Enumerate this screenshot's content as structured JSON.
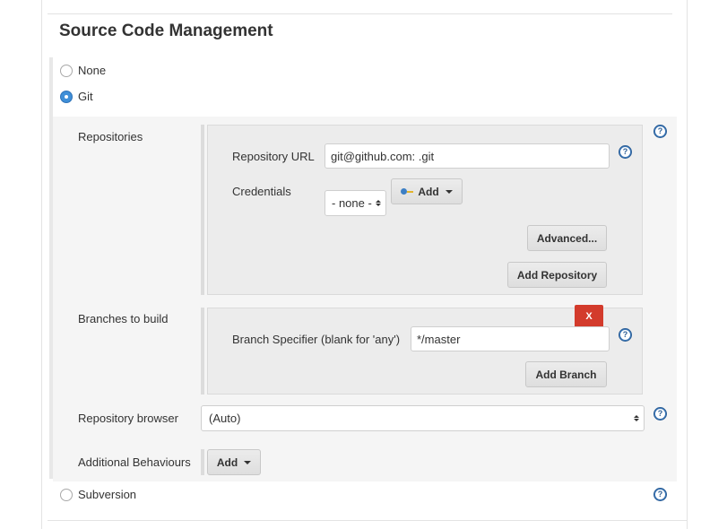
{
  "section": {
    "title": "Source Code Management"
  },
  "scm_options": {
    "none": "None",
    "git": "Git",
    "subversion": "Subversion",
    "selected": "Git"
  },
  "repositories": {
    "label": "Repositories",
    "url_label": "Repository URL",
    "url_value": "git@github.com:                          .git",
    "credentials_label": "Credentials",
    "credentials_value": "- none -",
    "add_label": "Add",
    "advanced_label": "Advanced...",
    "add_repository_label": "Add Repository"
  },
  "branches": {
    "label": "Branches to build",
    "delete_label": "X",
    "specifier_label": "Branch Specifier (blank for 'any')",
    "specifier_value": "*/master",
    "add_branch_label": "Add Branch"
  },
  "browser": {
    "label": "Repository browser",
    "value": "(Auto)"
  },
  "behaviours": {
    "label": "Additional Behaviours",
    "add_label": "Add"
  },
  "help": {
    "glyph": "?"
  },
  "colors": {
    "accent": "#3c78b9",
    "delete": "#d33b2c",
    "panel": "#f5f5f5"
  }
}
